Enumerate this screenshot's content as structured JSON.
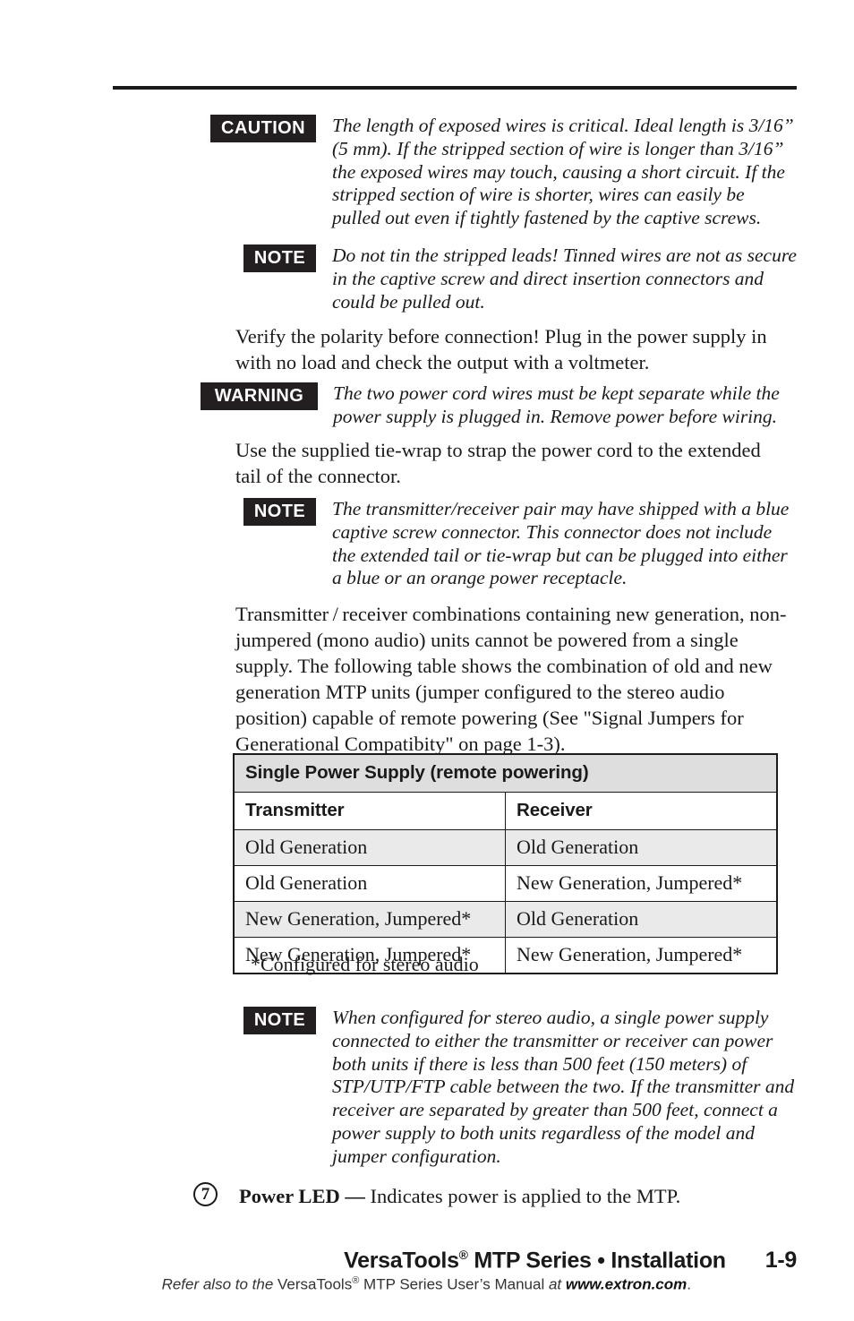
{
  "page": {
    "number": "1-9"
  },
  "callouts": {
    "caution1": {
      "tag": "CAUTION",
      "body": "The length of exposed wires is critical.  Ideal length is 3/16” (5 mm).  If the stripped section of wire is longer than 3/16” the exposed wires may touch, causing a short circuit. If the stripped section of wire is shorter, wires can easily be pulled out even if tightly fastened by the captive screws."
    },
    "note1": {
      "tag": "NOTE",
      "body": "Do not tin the stripped leads!  Tinned wires are not as secure in the captive screw and direct insertion connectors and could be pulled out."
    },
    "warning1": {
      "tag": "WARNING",
      "body": "The two power cord wires must be kept separate while the power supply is plugged in.  Remove power before wiring."
    },
    "note2": {
      "tag": "NOTE",
      "body": "The transmitter/receiver pair may have shipped with a blue captive screw connector.  This connector does not include the extended tail or tie-wrap but can be plugged into either a blue or an orange power receptacle."
    },
    "note3": {
      "tag": "NOTE",
      "body": "When configured for stereo audio, a single power supply connected to either the transmitter or receiver can power both units if there is less than 500 feet (150 meters) of STP/UTP/FTP cable between the two. If the transmitter and receiver are separated by greater than 500 feet, connect a power supply to both units regardless of the model and jumper configuration."
    }
  },
  "paragraphs": {
    "verify_polarity": "Verify the polarity before connection!  Plug in the power supply in with no load and check the output with a voltmeter.",
    "tie_wrap": "Use the supplied tie-wrap to strap the power cord to the extended tail of the connector.",
    "combinations": "Transmitter / receiver combinations containing new generation, non-jumpered (mono audio) units cannot be powered from a single supply.  The following table shows the combination of old and new generation MTP units (jumper configured to the stereo audio position) capable of remote powering (See \"Signal Jumpers for Generational Compatibity\" on page 1-3)."
  },
  "table": {
    "title": "Single Power Supply (remote powering)",
    "columns": [
      "Transmitter",
      "Receiver"
    ],
    "rows": [
      [
        "Old Generation",
        "Old Generation"
      ],
      [
        "Old Generation",
        "New Generation, Jumpered*"
      ],
      [
        "New Generation, Jumpered*",
        "Old Generation"
      ],
      [
        "New Generation, Jumpered*",
        "New Generation, Jumpered*"
      ]
    ]
  },
  "footnote": "*Configured for stereo audio",
  "numbered_item": {
    "number": "7",
    "label": "Power LED — ",
    "description": "Indicates power is applied to the MTP."
  },
  "footer": {
    "product": "VersaTools",
    "registered": "®",
    "title_rest": " MTP Series • Installation",
    "page_number": "1-9",
    "sub_a": "Refer also to the ",
    "sub_b": "VersaTools",
    "sub_reg": "®",
    "sub_c": " MTP Series User’s Manual ",
    "sub_at": "at ",
    "sub_url": "www.extron.com",
    "sub_period": "."
  }
}
